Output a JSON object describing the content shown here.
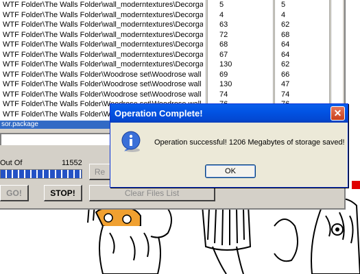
{
  "file_list": {
    "rows": [
      {
        "path": "WTF Folder\\The Walls Folder\\wall_moderntextures\\Decorga",
        "a": "5",
        "b": "5"
      },
      {
        "path": "WTF Folder\\The Walls Folder\\wall_moderntextures\\Decorga",
        "a": "4",
        "b": "4"
      },
      {
        "path": "WTF Folder\\The Walls Folder\\wall_moderntextures\\Decorga",
        "a": "63",
        "b": "62"
      },
      {
        "path": "WTF Folder\\The Walls Folder\\wall_moderntextures\\Decorga",
        "a": "72",
        "b": "68"
      },
      {
        "path": "WTF Folder\\The Walls Folder\\wall_moderntextures\\Decorga",
        "a": "68",
        "b": "64"
      },
      {
        "path": "WTF Folder\\The Walls Folder\\wall_moderntextures\\Decorga",
        "a": "67",
        "b": "64"
      },
      {
        "path": "WTF Folder\\The Walls Folder\\wall_moderntextures\\Decorga",
        "a": "130",
        "b": "62"
      },
      {
        "path": "WTF Folder\\The Walls Folder\\Woodrose set\\Woodrose wall",
        "a": "69",
        "b": "66"
      },
      {
        "path": "WTF Folder\\The Walls Folder\\Woodrose set\\Woodrose wall",
        "a": "130",
        "b": "47"
      },
      {
        "path": "WTF Folder\\The Walls Folder\\Woodrose set\\Woodrose wall",
        "a": "74",
        "b": "74"
      },
      {
        "path": "WTF Folder\\The Walls Folder\\Woodrose set\\Woodrose wall",
        "a": "76",
        "b": "76"
      },
      {
        "path": "WTF Folder\\The Walls Folder\\Woodrose set\\Woodrose wall",
        "a": "",
        "b": ""
      }
    ]
  },
  "status_bar": {
    "text": "sor.package"
  },
  "progress": {
    "label": "Out Of",
    "total": "11552",
    "fraction": 1.0
  },
  "buttons": {
    "go": "GO!",
    "stop": "STOP!",
    "clear": "Clear Files List",
    "re": "Re"
  },
  "dialog": {
    "title": "Operation Complete!",
    "message": "Operation successful! 1206 Megabytes of storage saved!",
    "ok": "OK",
    "close_glyph": "✕",
    "icon": "info-icon"
  },
  "colors": {
    "title_bar": "#0054e3",
    "selection": "#316ac5",
    "progress": "#2452c5",
    "accent_red": "#e00000"
  }
}
